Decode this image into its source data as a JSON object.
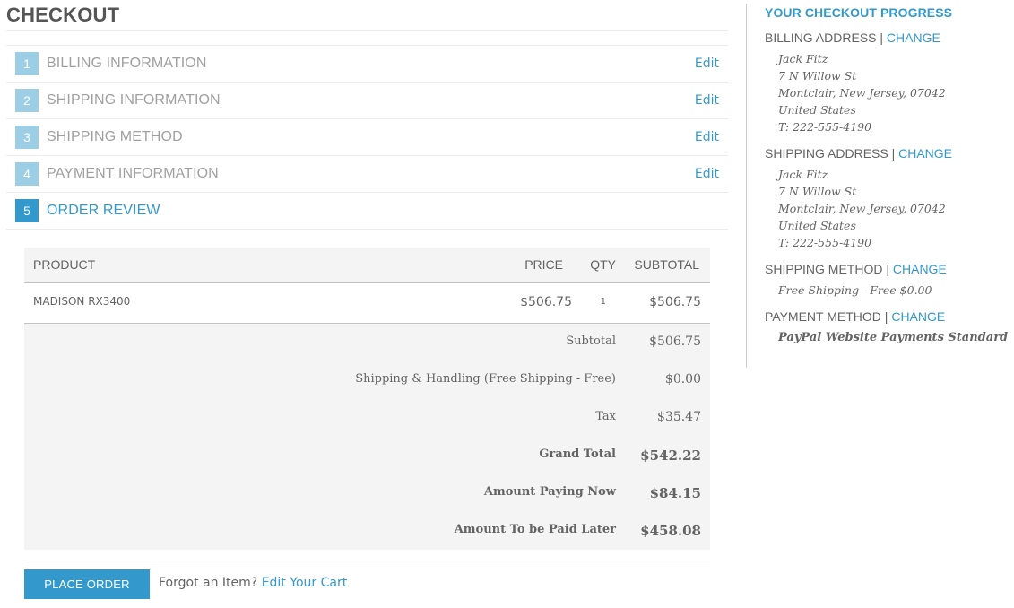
{
  "page": {
    "title": "CHECKOUT"
  },
  "steps": [
    {
      "number": "1",
      "label": "BILLING INFORMATION",
      "edit": "Edit",
      "active": false
    },
    {
      "number": "2",
      "label": "SHIPPING INFORMATION",
      "edit": "Edit",
      "active": false
    },
    {
      "number": "3",
      "label": "SHIPPING METHOD",
      "edit": "Edit",
      "active": false
    },
    {
      "number": "4",
      "label": "PAYMENT INFORMATION",
      "edit": "Edit",
      "active": false
    },
    {
      "number": "5",
      "label": "ORDER REVIEW",
      "edit": "",
      "active": true
    }
  ],
  "review": {
    "columns": {
      "product": "PRODUCT",
      "price": "PRICE",
      "qty": "QTY",
      "subtotal": "SUBTOTAL"
    },
    "items": [
      {
        "product": "MADISON RX3400",
        "price": "$506.75",
        "qty": "1",
        "subtotal": "$506.75"
      }
    ],
    "totals": [
      {
        "label": "Subtotal",
        "value": "$506.75",
        "bold": false
      },
      {
        "label": "Shipping & Handling (Free Shipping - Free)",
        "value": "$0.00",
        "bold": false
      },
      {
        "label": "Tax",
        "value": "$35.47",
        "bold": false
      },
      {
        "label": "Grand Total",
        "value": "$542.22",
        "bold": true
      },
      {
        "label": "Amount Paying Now",
        "value": "$84.15",
        "bold": true
      },
      {
        "label": "Amount To be Paid Later",
        "value": "$458.08",
        "bold": true
      }
    ]
  },
  "actions": {
    "place_order": "PLACE ORDER",
    "forgot_text": "Forgot an Item?",
    "edit_cart": "Edit Your Cart"
  },
  "sidebar": {
    "title": "YOUR CHECKOUT PROGRESS",
    "separator": "|",
    "billing": {
      "heading": "BILLING ADDRESS",
      "change": "CHANGE",
      "lines": [
        "Jack Fitz",
        "7 N Willow St",
        "Montclair, New Jersey, 07042",
        "United States",
        "T: 222-555-4190"
      ]
    },
    "shipping": {
      "heading": "SHIPPING ADDRESS",
      "change": "CHANGE",
      "lines": [
        "Jack Fitz",
        "7 N Willow St",
        "Montclair, New Jersey, 07042",
        "United States",
        "T: 222-555-4190"
      ]
    },
    "shipping_method": {
      "heading": "SHIPPING METHOD",
      "change": "CHANGE",
      "value": "Free Shipping - Free $0.00"
    },
    "payment_method": {
      "heading": "PAYMENT METHOD",
      "change": "CHANGE",
      "value": "PayPal Website Payments Standard"
    }
  },
  "colors": {
    "accent": "#3399cc",
    "step_inactive": "#9ccfe6",
    "panel_bg": "#f4f4f4",
    "text": "#636363"
  }
}
